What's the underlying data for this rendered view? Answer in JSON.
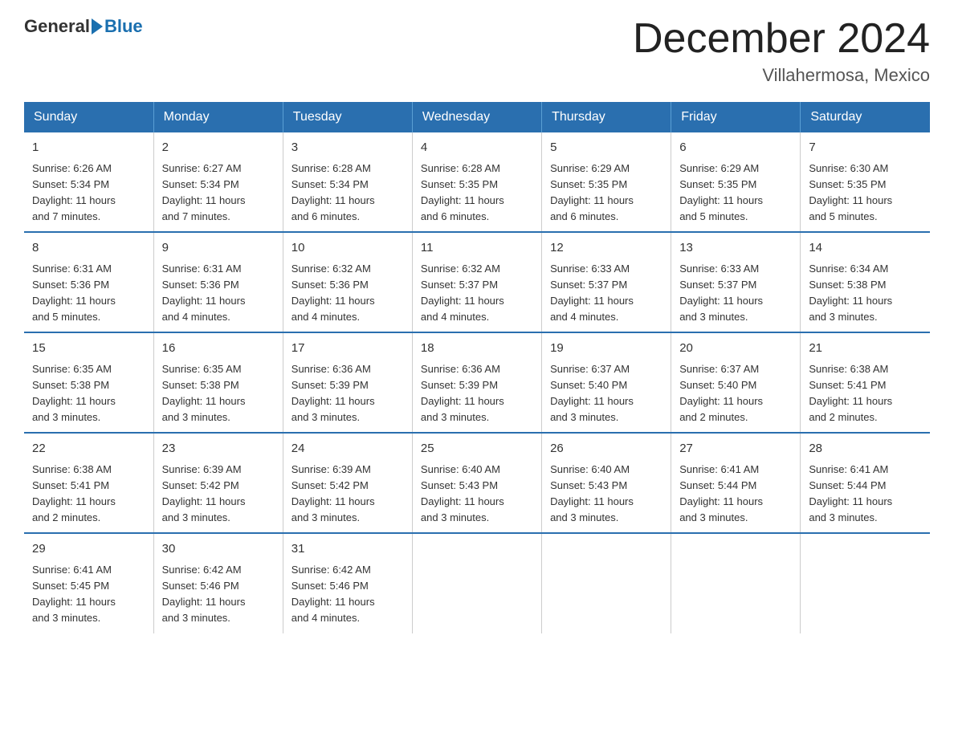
{
  "logo": {
    "general": "General",
    "blue": "Blue"
  },
  "title": "December 2024",
  "location": "Villahermosa, Mexico",
  "days_of_week": [
    "Sunday",
    "Monday",
    "Tuesday",
    "Wednesday",
    "Thursday",
    "Friday",
    "Saturday"
  ],
  "weeks": [
    [
      {
        "day": "1",
        "sunrise": "6:26 AM",
        "sunset": "5:34 PM",
        "daylight": "11 hours and 7 minutes."
      },
      {
        "day": "2",
        "sunrise": "6:27 AM",
        "sunset": "5:34 PM",
        "daylight": "11 hours and 7 minutes."
      },
      {
        "day": "3",
        "sunrise": "6:28 AM",
        "sunset": "5:34 PM",
        "daylight": "11 hours and 6 minutes."
      },
      {
        "day": "4",
        "sunrise": "6:28 AM",
        "sunset": "5:35 PM",
        "daylight": "11 hours and 6 minutes."
      },
      {
        "day": "5",
        "sunrise": "6:29 AM",
        "sunset": "5:35 PM",
        "daylight": "11 hours and 6 minutes."
      },
      {
        "day": "6",
        "sunrise": "6:29 AM",
        "sunset": "5:35 PM",
        "daylight": "11 hours and 5 minutes."
      },
      {
        "day": "7",
        "sunrise": "6:30 AM",
        "sunset": "5:35 PM",
        "daylight": "11 hours and 5 minutes."
      }
    ],
    [
      {
        "day": "8",
        "sunrise": "6:31 AM",
        "sunset": "5:36 PM",
        "daylight": "11 hours and 5 minutes."
      },
      {
        "day": "9",
        "sunrise": "6:31 AM",
        "sunset": "5:36 PM",
        "daylight": "11 hours and 4 minutes."
      },
      {
        "day": "10",
        "sunrise": "6:32 AM",
        "sunset": "5:36 PM",
        "daylight": "11 hours and 4 minutes."
      },
      {
        "day": "11",
        "sunrise": "6:32 AM",
        "sunset": "5:37 PM",
        "daylight": "11 hours and 4 minutes."
      },
      {
        "day": "12",
        "sunrise": "6:33 AM",
        "sunset": "5:37 PM",
        "daylight": "11 hours and 4 minutes."
      },
      {
        "day": "13",
        "sunrise": "6:33 AM",
        "sunset": "5:37 PM",
        "daylight": "11 hours and 3 minutes."
      },
      {
        "day": "14",
        "sunrise": "6:34 AM",
        "sunset": "5:38 PM",
        "daylight": "11 hours and 3 minutes."
      }
    ],
    [
      {
        "day": "15",
        "sunrise": "6:35 AM",
        "sunset": "5:38 PM",
        "daylight": "11 hours and 3 minutes."
      },
      {
        "day": "16",
        "sunrise": "6:35 AM",
        "sunset": "5:38 PM",
        "daylight": "11 hours and 3 minutes."
      },
      {
        "day": "17",
        "sunrise": "6:36 AM",
        "sunset": "5:39 PM",
        "daylight": "11 hours and 3 minutes."
      },
      {
        "day": "18",
        "sunrise": "6:36 AM",
        "sunset": "5:39 PM",
        "daylight": "11 hours and 3 minutes."
      },
      {
        "day": "19",
        "sunrise": "6:37 AM",
        "sunset": "5:40 PM",
        "daylight": "11 hours and 3 minutes."
      },
      {
        "day": "20",
        "sunrise": "6:37 AM",
        "sunset": "5:40 PM",
        "daylight": "11 hours and 2 minutes."
      },
      {
        "day": "21",
        "sunrise": "6:38 AM",
        "sunset": "5:41 PM",
        "daylight": "11 hours and 2 minutes."
      }
    ],
    [
      {
        "day": "22",
        "sunrise": "6:38 AM",
        "sunset": "5:41 PM",
        "daylight": "11 hours and 2 minutes."
      },
      {
        "day": "23",
        "sunrise": "6:39 AM",
        "sunset": "5:42 PM",
        "daylight": "11 hours and 3 minutes."
      },
      {
        "day": "24",
        "sunrise": "6:39 AM",
        "sunset": "5:42 PM",
        "daylight": "11 hours and 3 minutes."
      },
      {
        "day": "25",
        "sunrise": "6:40 AM",
        "sunset": "5:43 PM",
        "daylight": "11 hours and 3 minutes."
      },
      {
        "day": "26",
        "sunrise": "6:40 AM",
        "sunset": "5:43 PM",
        "daylight": "11 hours and 3 minutes."
      },
      {
        "day": "27",
        "sunrise": "6:41 AM",
        "sunset": "5:44 PM",
        "daylight": "11 hours and 3 minutes."
      },
      {
        "day": "28",
        "sunrise": "6:41 AM",
        "sunset": "5:44 PM",
        "daylight": "11 hours and 3 minutes."
      }
    ],
    [
      {
        "day": "29",
        "sunrise": "6:41 AM",
        "sunset": "5:45 PM",
        "daylight": "11 hours and 3 minutes."
      },
      {
        "day": "30",
        "sunrise": "6:42 AM",
        "sunset": "5:46 PM",
        "daylight": "11 hours and 3 minutes."
      },
      {
        "day": "31",
        "sunrise": "6:42 AM",
        "sunset": "5:46 PM",
        "daylight": "11 hours and 4 minutes."
      },
      null,
      null,
      null,
      null
    ]
  ]
}
